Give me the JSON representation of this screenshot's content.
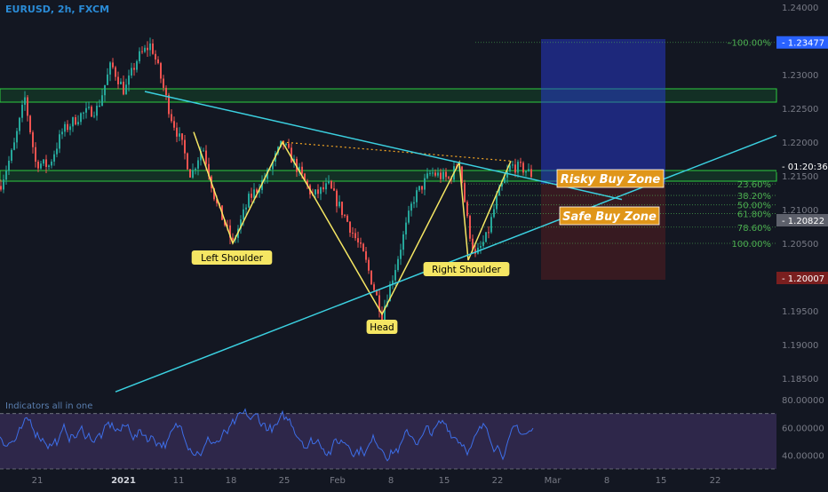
{
  "header": {
    "symbol": "EURUSD, 2h, FXCM"
  },
  "chart_data": [
    {
      "type": "line",
      "title": "EURUSD, 2h, FXCM",
      "x_tick_labels": [
        "21",
        "2021",
        "11",
        "18",
        "25",
        "Feb",
        "8",
        "15",
        "22",
        "Mar",
        "8",
        "15",
        "22"
      ],
      "y_ticks": [
        1.24,
        1.235,
        1.23,
        1.225,
        1.22,
        1.215,
        1.21,
        1.205,
        1.2,
        1.195,
        1.19,
        1.185
      ],
      "ylim": [
        1.1825,
        1.24
      ],
      "grid": false,
      "price_labels": [
        {
          "value": "1.23477",
          "color": "#2962ff"
        },
        {
          "value": "01:20:36",
          "color": "#131722"
        },
        {
          "value": "1.20822",
          "color": "#5d606b"
        },
        {
          "value": "1.20007",
          "color": "#7a1f1f"
        }
      ],
      "key_points": [
        {
          "label": "Left Shoulder",
          "price": 1.205
        },
        {
          "label": "Head",
          "price": 1.1945
        },
        {
          "label": "Right Shoulder",
          "price": 1.2025
        }
      ],
      "neckline_peaks": [
        1.22,
        1.217
      ],
      "fib_levels": [
        {
          "label": "–100.00%",
          "price": 1.23477
        },
        {
          "label": "23.60%",
          "price": 1.2138
        },
        {
          "label": "38.20%",
          "price": 1.2121
        },
        {
          "label": "50.00%",
          "price": 1.2107
        },
        {
          "label": "61.80%",
          "price": 1.2094
        },
        {
          "label": "78.60%",
          "price": 1.2074
        },
        {
          "label": "100.00%",
          "price": 1.205
        }
      ],
      "zones": [
        {
          "label": "Risky Buy Zone",
          "price": 1.2148
        },
        {
          "label": "Safe Buy Zone",
          "price": 1.21
        }
      ],
      "colors": {
        "up": "#26a69a",
        "down": "#ef5350",
        "pattern": "#f5e663",
        "trendline": "#3bd0e0",
        "zone_label": "#e0961a",
        "fib": "#4caf50"
      }
    },
    {
      "type": "line",
      "title": "Indicators all in one",
      "y_ticks": [
        "80.00000",
        "60.00000",
        "40.00000"
      ],
      "ylim": [
        30,
        82
      ],
      "bands": [
        70,
        30
      ],
      "line_color": "#3d6ee8"
    }
  ]
}
